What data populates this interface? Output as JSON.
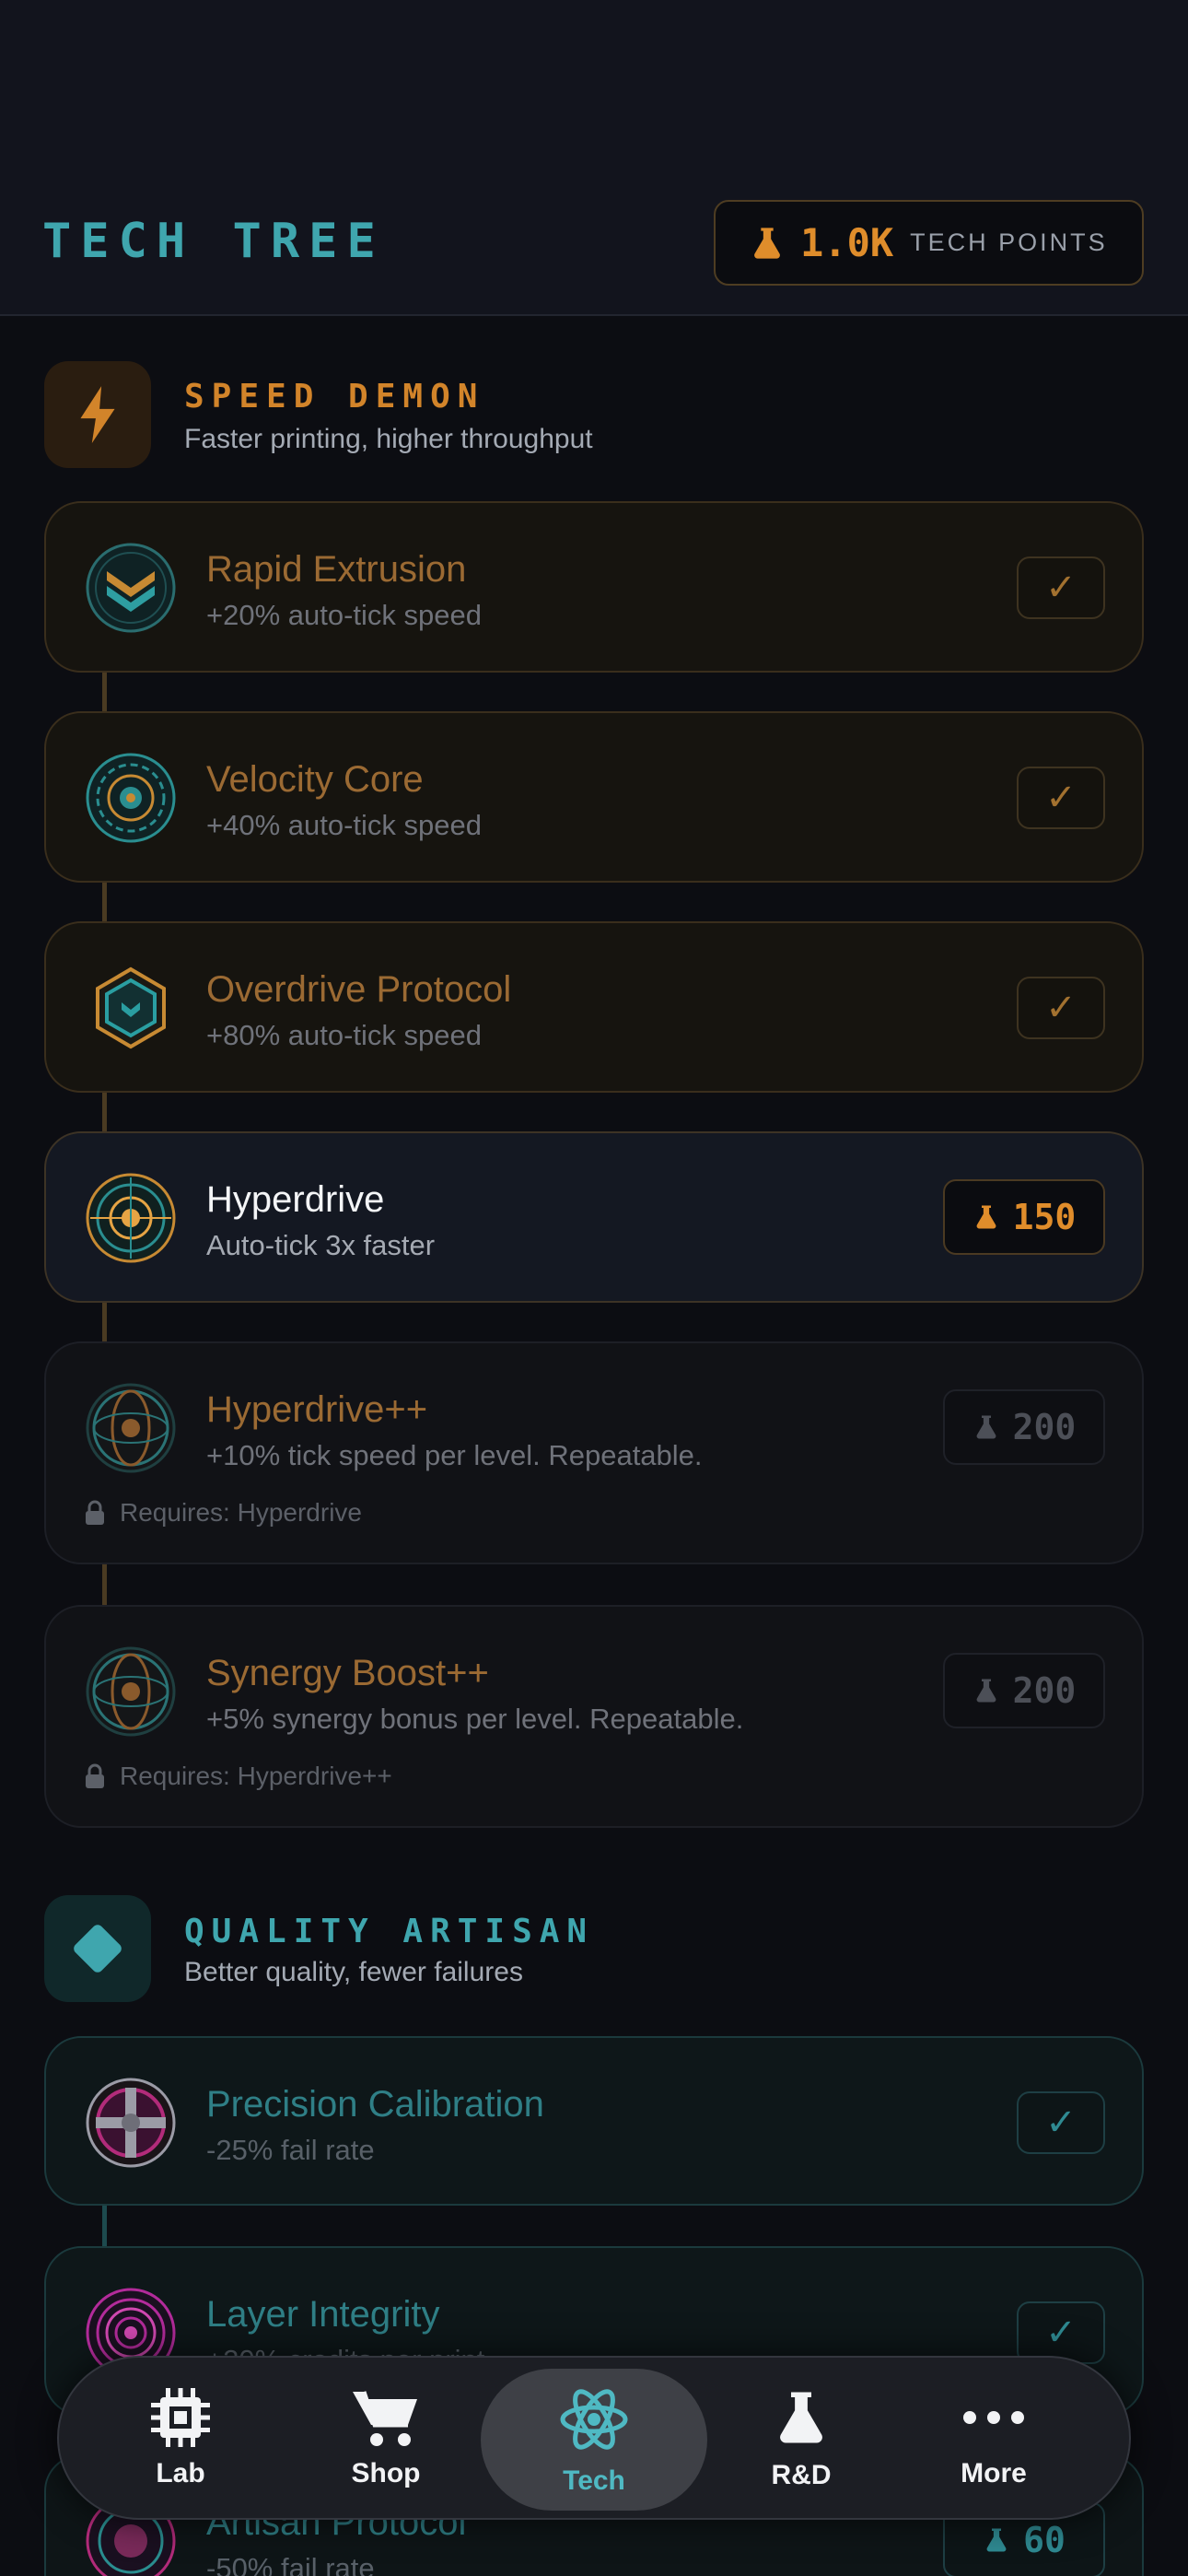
{
  "header": {
    "title": "TECH TREE",
    "points_value": "1.0K",
    "points_label": "TECH POINTS"
  },
  "sections": [
    {
      "title": "SPEED DEMON",
      "description": "Faster printing, higher throughput",
      "icon": "lightning-icon",
      "accent": "#d2842a"
    },
    {
      "title": "QUALITY ARTISAN",
      "description": "Better quality, fewer failures",
      "icon": "diamond-icon",
      "accent": "#3fa6ae"
    }
  ],
  "upgrades": [
    {
      "name": "Rapid Extrusion",
      "description": "+20% auto-tick speed",
      "status": "purchased",
      "check": "✓"
    },
    {
      "name": "Velocity Core",
      "description": "+40% auto-tick speed",
      "status": "purchased",
      "check": "✓"
    },
    {
      "name": "Overdrive Protocol",
      "description": "+80% auto-tick speed",
      "status": "purchased",
      "check": "✓"
    },
    {
      "name": "Hyperdrive",
      "description": "Auto-tick 3x faster",
      "status": "available",
      "cost": "150"
    },
    {
      "name": "Hyperdrive++",
      "description": "+10% tick speed per level. Repeatable.",
      "status": "locked",
      "cost": "200",
      "requires": "Requires: Hyperdrive"
    },
    {
      "name": "Synergy Boost++",
      "description": "+5% synergy bonus per level. Repeatable.",
      "status": "locked",
      "cost": "200",
      "requires": "Requires: Hyperdrive++"
    },
    {
      "name": "Precision Calibration",
      "description": "-25% fail rate",
      "status": "purchased",
      "check": "✓"
    },
    {
      "name": "Layer Integrity",
      "description": "+20% credits per print",
      "status": "purchased",
      "check": "✓"
    },
    {
      "name": "Artisan Protocol",
      "description": "-50% fail rate",
      "status": "available",
      "cost": "60"
    }
  ],
  "nav": {
    "items": [
      {
        "label": "Lab",
        "icon": "chip-icon"
      },
      {
        "label": "Shop",
        "icon": "cart-icon"
      },
      {
        "label": "Tech",
        "icon": "atom-icon",
        "active": true
      },
      {
        "label": "R&D",
        "icon": "flask-icon"
      },
      {
        "label": "More",
        "icon": "more-dots-icon"
      }
    ]
  },
  "colors": {
    "orange": "#df8d2b",
    "teal": "#3fa6ae",
    "background": "#0c0d12"
  }
}
